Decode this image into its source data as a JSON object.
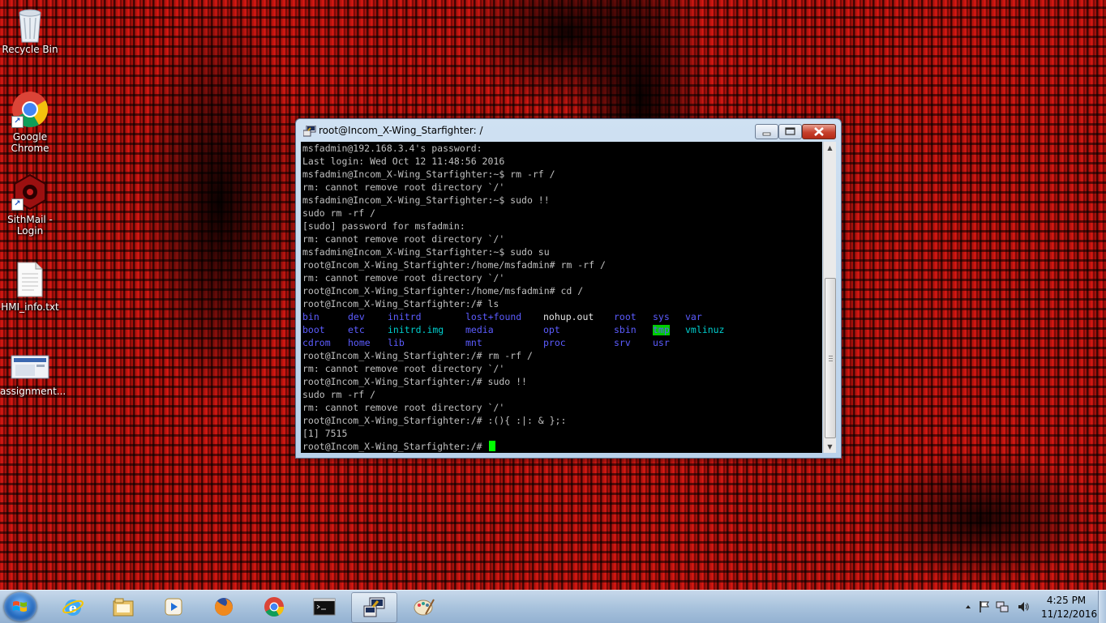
{
  "desktop": {
    "icons": [
      {
        "label": "Recycle Bin",
        "icon": "recycle-bin-icon"
      },
      {
        "label": "Google Chrome",
        "icon": "chrome-icon"
      },
      {
        "label": "SithMail - Login",
        "icon": "sithmail-icon"
      },
      {
        "label": "HMI_info.txt",
        "icon": "text-file-icon"
      },
      {
        "label": "assignment...",
        "icon": "image-file-icon"
      }
    ]
  },
  "window": {
    "title": "root@Incom_X-Wing_Starfighter: /"
  },
  "terminal": {
    "lines_before_ls": [
      "msfadmin@192.168.3.4's password:",
      "Last login: Wed Oct 12 11:48:56 2016",
      "msfadmin@Incom_X-Wing_Starfighter:~$ rm -rf /",
      "rm: cannot remove root directory `/'",
      "msfadmin@Incom_X-Wing_Starfighter:~$ sudo !!",
      "sudo rm -rf /",
      "[sudo] password for msfadmin:",
      "rm: cannot remove root directory `/'",
      "msfadmin@Incom_X-Wing_Starfighter:~$ sudo su",
      "root@Incom_X-Wing_Starfighter:/home/msfadmin# rm -rf /",
      "rm: cannot remove root directory `/'",
      "root@Incom_X-Wing_Starfighter:/home/msfadmin# cd /",
      "root@Incom_X-Wing_Starfighter:/# ls"
    ],
    "ls_output": [
      [
        "bin",
        "dev",
        "initrd",
        "lost+found",
        "nohup.out",
        "root",
        "sys",
        "var"
      ],
      [
        "boot",
        "etc",
        "initrd.img",
        "media",
        "opt",
        "sbin",
        "tmp",
        "vmlinuz"
      ],
      [
        "cdrom",
        "home",
        "lib",
        "mnt",
        "proc",
        "srv",
        "usr",
        ""
      ]
    ],
    "lines_after_ls": [
      "root@Incom_X-Wing_Starfighter:/# rm -rf /",
      "rm: cannot remove root directory `/'",
      "root@Incom_X-Wing_Starfighter:/# sudo !!",
      "sudo rm -rf /",
      "rm: cannot remove root directory `/'",
      "root@Incom_X-Wing_Starfighter:/# :(){ :|: & };:",
      "[1] 7515"
    ],
    "prompt": "root@Incom_X-Wing_Starfighter:/# ",
    "colors": {
      "text": "#c0c0c0",
      "dir": "#5c5cff",
      "link": "#00cdcd",
      "file": "#e5e5e5",
      "tmp_bg": "#00cd00",
      "cursor": "#00ff00"
    }
  },
  "taskbar": {
    "buttons": [
      {
        "name": "internet-explorer-icon"
      },
      {
        "name": "file-explorer-icon"
      },
      {
        "name": "media-player-icon"
      },
      {
        "name": "firefox-icon"
      },
      {
        "name": "chrome-icon"
      },
      {
        "name": "command-prompt-icon"
      },
      {
        "name": "putty-icon",
        "active": true
      },
      {
        "name": "paint-icon"
      }
    ],
    "clock": {
      "time": "4:25 PM",
      "date": "11/12/2016"
    }
  }
}
